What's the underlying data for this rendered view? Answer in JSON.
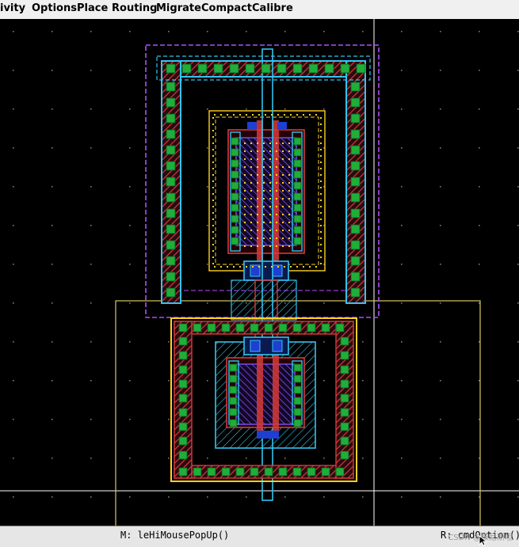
{
  "menu": [
    "ivity",
    "Options",
    "Place",
    "Routing",
    "Migrate",
    "Compact",
    "Calibre"
  ],
  "status": {
    "mouse_left": "M: leHiMousePopUp()",
    "mouse_right": "R: cmdOption()"
  },
  "watermark": "CSDN @滕尼斯坦",
  "colors": {
    "background": "#000000",
    "poly": "#d63a3a",
    "diffusion": "#1fae3a",
    "metal1": "#33c4ef",
    "metal2": "#7a52ff",
    "nwell": "#b24cff",
    "implant": "#ffd21f",
    "contact": "#1f3fd0"
  }
}
